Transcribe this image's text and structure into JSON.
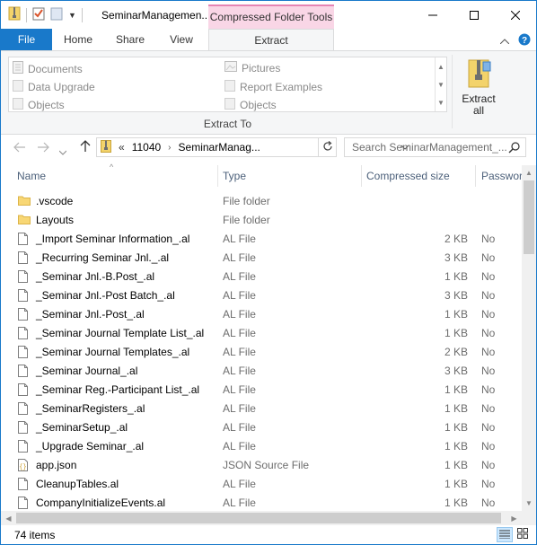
{
  "window": {
    "title": "SeminarManagemen...",
    "context_tab_title": "Compressed Folder Tools"
  },
  "ribbon": {
    "tabs": [
      {
        "label": "File"
      },
      {
        "label": "Home"
      },
      {
        "label": "Share"
      },
      {
        "label": "View"
      },
      {
        "label": "Extract"
      }
    ],
    "extract_to_items": [
      "Documents",
      "Pictures",
      "Data Upgrade",
      "Report Examples",
      "Objects",
      "Objects"
    ],
    "group_label": "Extract To",
    "extract_all_label_1": "Extract",
    "extract_all_label_2": "all"
  },
  "address": {
    "overflow": "«",
    "crumbs": [
      "11040",
      "SeminarManag..."
    ],
    "search_placeholder": "Search SeminarManagement_..."
  },
  "columns": {
    "name": "Name",
    "type": "Type",
    "size": "Compressed size",
    "password": "Passwor"
  },
  "files": [
    {
      "name": ".vscode",
      "type": "File folder",
      "size": "",
      "pw": "",
      "kind": "folder"
    },
    {
      "name": "Layouts",
      "type": "File folder",
      "size": "",
      "pw": "",
      "kind": "folder"
    },
    {
      "name": "_Import Seminar Information_.al",
      "type": "AL File",
      "size": "2 KB",
      "pw": "No",
      "kind": "file"
    },
    {
      "name": "_Recurring Seminar Jnl._.al",
      "type": "AL File",
      "size": "3 KB",
      "pw": "No",
      "kind": "file"
    },
    {
      "name": "_Seminar Jnl.-B.Post_.al",
      "type": "AL File",
      "size": "1 KB",
      "pw": "No",
      "kind": "file"
    },
    {
      "name": "_Seminar Jnl.-Post Batch_.al",
      "type": "AL File",
      "size": "3 KB",
      "pw": "No",
      "kind": "file"
    },
    {
      "name": "_Seminar Jnl.-Post_.al",
      "type": "AL File",
      "size": "1 KB",
      "pw": "No",
      "kind": "file"
    },
    {
      "name": "_Seminar Journal Template List_.al",
      "type": "AL File",
      "size": "1 KB",
      "pw": "No",
      "kind": "file"
    },
    {
      "name": "_Seminar Journal Templates_.al",
      "type": "AL File",
      "size": "2 KB",
      "pw": "No",
      "kind": "file"
    },
    {
      "name": "_Seminar Journal_.al",
      "type": "AL File",
      "size": "3 KB",
      "pw": "No",
      "kind": "file"
    },
    {
      "name": "_Seminar Reg.-Participant List_.al",
      "type": "AL File",
      "size": "1 KB",
      "pw": "No",
      "kind": "file"
    },
    {
      "name": "_SeminarRegisters_.al",
      "type": "AL File",
      "size": "1 KB",
      "pw": "No",
      "kind": "file"
    },
    {
      "name": "_SeminarSetup_.al",
      "type": "AL File",
      "size": "1 KB",
      "pw": "No",
      "kind": "file"
    },
    {
      "name": "_Upgrade Seminar_.al",
      "type": "AL File",
      "size": "1 KB",
      "pw": "No",
      "kind": "file"
    },
    {
      "name": "app.json",
      "type": "JSON Source File",
      "size": "1 KB",
      "pw": "No",
      "kind": "json"
    },
    {
      "name": "CleanupTables.al",
      "type": "AL File",
      "size": "1 KB",
      "pw": "No",
      "kind": "file"
    },
    {
      "name": "CompanyInitializeEvents.al",
      "type": "AL File",
      "size": "1 KB",
      "pw": "No",
      "kind": "file"
    }
  ],
  "status": {
    "item_count": "74 items"
  }
}
